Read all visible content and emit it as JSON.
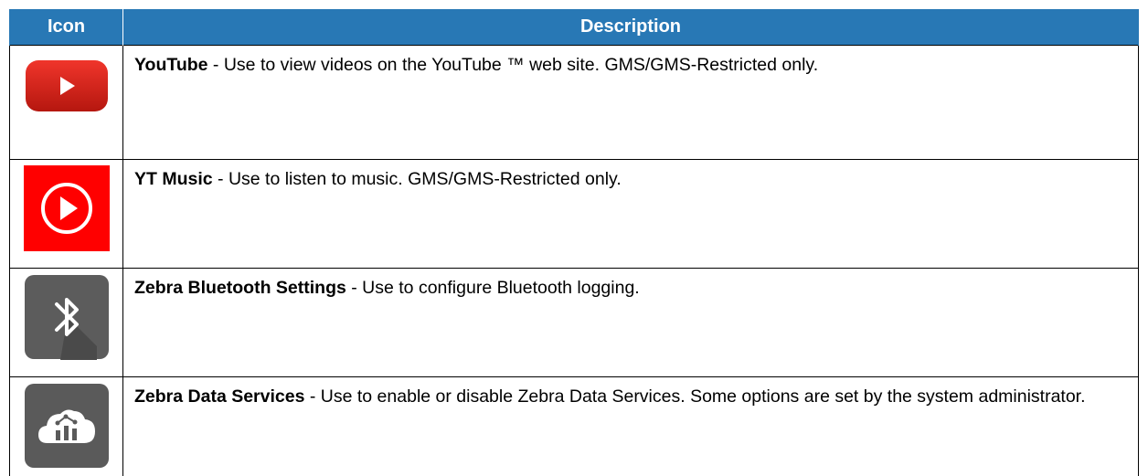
{
  "table": {
    "headers": {
      "icon": "Icon",
      "description": "Description"
    },
    "rows": [
      {
        "icon": "youtube-icon",
        "name": "YouTube",
        "text": " - Use to view videos on the YouTube ™ web site. GMS/GMS-Restricted only."
      },
      {
        "icon": "yt-music-icon",
        "name": "YT Music",
        "text": " - Use to listen to music. GMS/GMS-Restricted only."
      },
      {
        "icon": "bluetooth-icon",
        "name": "Zebra Bluetooth Settings",
        "text": " - Use to configure Bluetooth logging."
      },
      {
        "icon": "cloud-analytics-icon",
        "name": "Zebra Data Services",
        "text": " - Use to enable or disable Zebra Data Services. Some options are set by the system administrator."
      }
    ]
  },
  "colors": {
    "header_bg": "#2878b5",
    "youtube_red": "#e62117",
    "yt_music_red": "#ff0000",
    "icon_gray": "#5a5a5a"
  }
}
